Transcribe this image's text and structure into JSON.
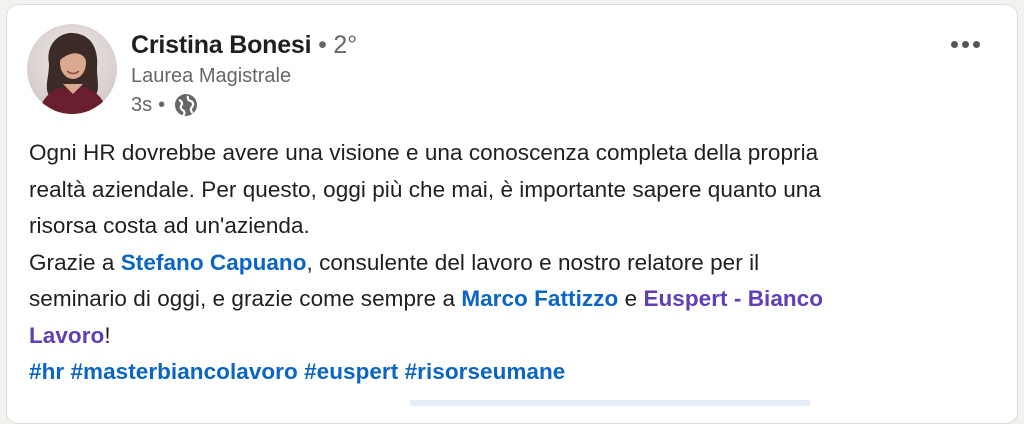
{
  "post": {
    "author": {
      "name": "Cristina Bonesi",
      "degree": " • 2°",
      "headline": "Laurea Magistrale",
      "time": "3s",
      "dot": "•",
      "visibility_icon": "globe-icon"
    },
    "more_icon": "ellipsis-icon",
    "body": {
      "line1": "Ogni HR dovrebbe avere una visione e una conoscenza completa della propria",
      "line2": "realtà aziendale. Per questo, oggi più che mai, è importante sapere quanto una",
      "line3": "risorsa costa ad un'azienda.",
      "line4_prefix": "Grazie a ",
      "mention1": "Stefano Capuano",
      "line4_suffix": ", consulente del lavoro e nostro relatore per il",
      "line5_prefix": "seminario di oggi, e grazie come sempre a ",
      "mention2": "Marco Fattizzo",
      "between": " e ",
      "mention3_part1": "Euspert - Bianco",
      "mention3_part2": "Lavoro",
      "end": "!",
      "hashtags": [
        "#hr",
        "#masterbiancolavoro",
        "#euspert",
        "#risorseumane"
      ]
    }
  },
  "colors": {
    "link_blue": "#0a66c2",
    "link_purple": "#5f3fb3",
    "text": "#1f1f1f",
    "muted": "#666666"
  }
}
